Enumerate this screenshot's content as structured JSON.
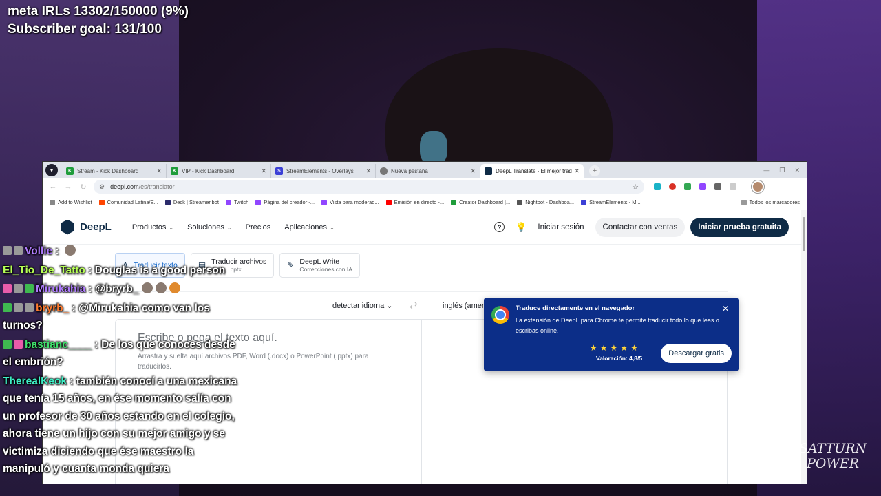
{
  "stream_overlay": {
    "meta_line": "meta IRLs 13302/150000 (9%)",
    "subs_line": "Subscriber goal: 131/100"
  },
  "browser": {
    "tabs": [
      {
        "label": "Stream - Kick Dashboard",
        "icon": "kick-icon",
        "color": "#1f9d3b",
        "active": false
      },
      {
        "label": "VIP - Kick Dashboard",
        "icon": "kick-icon",
        "color": "#1f9d3b",
        "active": false
      },
      {
        "label": "StreamElements - Overlays",
        "icon": "streamelements-icon",
        "color": "#3b3fd6",
        "active": false
      },
      {
        "label": "Nueva pestaña",
        "icon": "chrome-icon",
        "color": "#777777",
        "active": false
      },
      {
        "label": "DeepL Translate - El mejor trad",
        "icon": "deepl-icon",
        "color": "#0f2b46",
        "active": true
      }
    ],
    "url_host": "deepl.com",
    "url_path": "/es/translator",
    "bookmarks": [
      {
        "label": "Add to Wishlist",
        "color": "#888888"
      },
      {
        "label": "Comunidad Latina/E...",
        "color": "#ff4500"
      },
      {
        "label": "Deck | Streamer.bot",
        "color": "#2b2b6b"
      },
      {
        "label": "Twitch",
        "color": "#9146ff"
      },
      {
        "label": "Página del creador -...",
        "color": "#9146ff"
      },
      {
        "label": "Vista para moderad...",
        "color": "#9146ff"
      },
      {
        "label": "Emisión en directo -...",
        "color": "#ff0000"
      },
      {
        "label": "Creator Dashboard |...",
        "color": "#1f9d3b"
      },
      {
        "label": "Nightbot - Dashboa...",
        "color": "#555555"
      },
      {
        "label": "StreamElements - M...",
        "color": "#3b3fd6"
      }
    ],
    "all_bookmarks": "Todos los marcadores"
  },
  "deepl": {
    "logo": "DeepL",
    "nav": [
      "Productos",
      "Soluciones",
      "Precios",
      "Aplicaciones"
    ],
    "login": "Iniciar sesión",
    "sales": "Contactar con ventas",
    "trial": "Iniciar prueba gratuita",
    "modes": [
      {
        "title": "Traducir texto",
        "sub": ""
      },
      {
        "title": "Traducir archivos",
        "sub": ".docx, .pptx"
      },
      {
        "title": "DeepL Write",
        "sub": "Correcciones con IA"
      }
    ],
    "source_lang": "detectar idioma",
    "target_lang": "inglés (ameri",
    "placeholder_main": "Escribe o pega el texto aquí.",
    "placeholder_sub": "Arrastra y suelta aquí archivos PDF, Word (.docx) o PowerPoint (.pptx) para traducirlos.",
    "popup": {
      "title": "Traduce directamente en el navegador",
      "body": "La extensión de DeepL para Chrome te permite traducir todo lo que leas o escribas online.",
      "rating": "Valoración: 4,8/5",
      "button": "Descargar gratis"
    }
  },
  "chat": [
    {
      "user": "Vollie",
      "text": ""
    },
    {
      "user": "El_Tio_De_Tatto",
      "text": "Douglas is a good person"
    },
    {
      "user": "Mirukahia",
      "text": "@bryrb_"
    },
    {
      "user": "bryrb_",
      "text": "@Mirukahia como van los turnos?"
    },
    {
      "user": "bastianc____",
      "text": "De los que conoces desde el embrión?"
    },
    {
      "user": "TherealKeok",
      "text": "también conocí a una mexicana que tenía 15 años, en ése momento salía con un profesor de 30 años estando en el colegio, ahora tiene un hijo con su mejor amigo y se victimiza diciendo que ése maestro la manipuló y cuanta monda quiera"
    }
  ],
  "watermark": "SATTURN POWER"
}
